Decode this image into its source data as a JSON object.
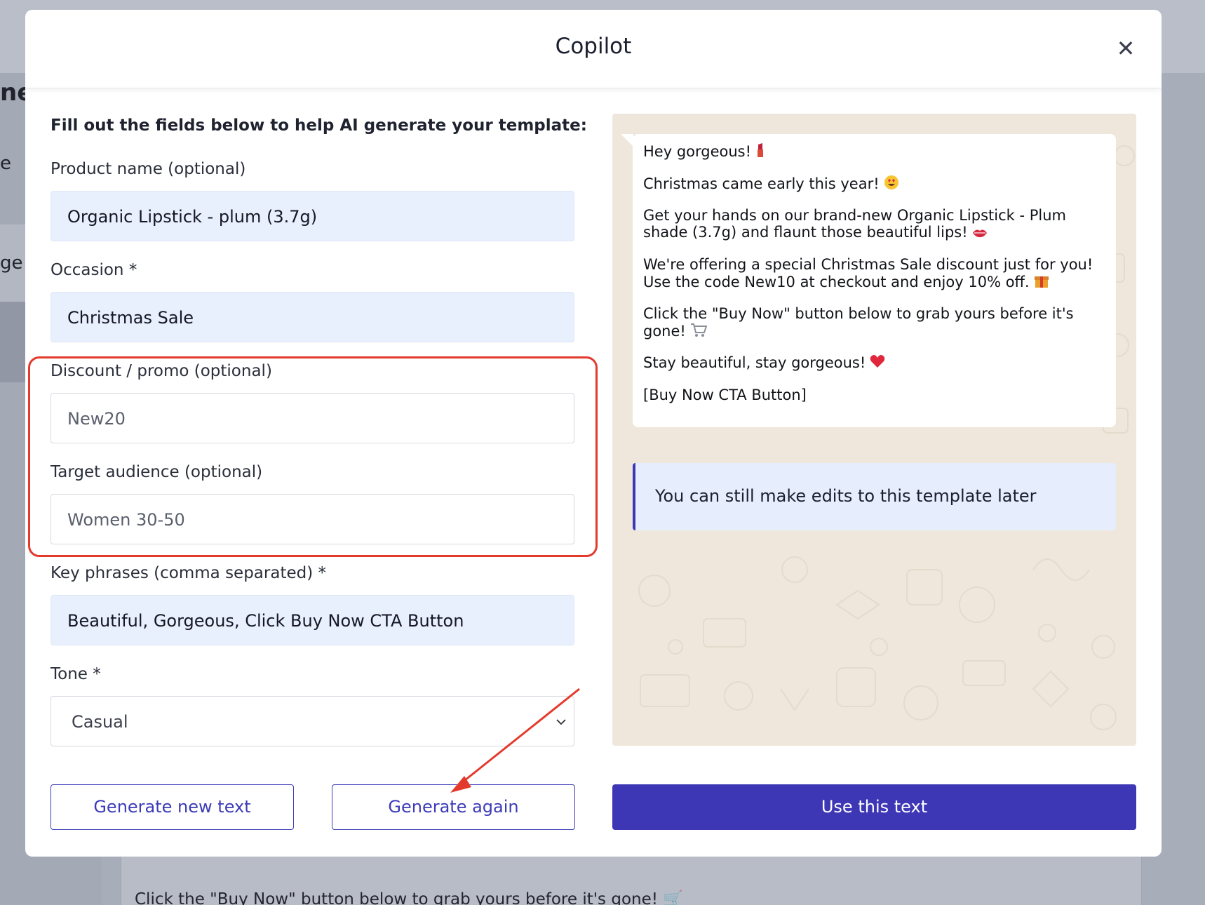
{
  "background": {
    "fragment_title": "nes",
    "fragment_a": "e",
    "fragment_b": "ge",
    "card_text": "Click the \"Buy Now\" button below to grab yours before it's gone! 🛒"
  },
  "modal": {
    "title": "Copilot",
    "close_icon": "close-icon"
  },
  "form": {
    "intro": "Fill out the fields below to help AI generate your template:",
    "product": {
      "label": "Product name (optional)",
      "value": "Organic Lipstick - plum (3.7g)"
    },
    "occasion": {
      "label": "Occasion *",
      "value": "Christmas Sale"
    },
    "discount": {
      "label": "Discount / promo (optional)",
      "placeholder": "New20"
    },
    "audience": {
      "label": "Target audience (optional)",
      "placeholder": "Women 30-50"
    },
    "key_phrases": {
      "label": "Key phrases (comma separated) *",
      "value": "Beautiful, Gorgeous, Click Buy Now CTA Button"
    },
    "tone": {
      "label": "Tone *",
      "value": "Casual"
    }
  },
  "buttons": {
    "generate_new": "Generate new text",
    "generate_again": "Generate again",
    "use_text": "Use this text"
  },
  "preview": {
    "lines": [
      "Hey gorgeous!",
      "Christmas came early this year!",
      "Get your hands on our brand-new Organic Lipstick - Plum",
      "shade (3.7g) and flaunt those beautiful lips!",
      "We're offering a special Christmas Sale discount just for you!",
      "Use the code New10 at checkout and enjoy 10% off.",
      "Click the \"Buy Now\" button below to grab yours before it's",
      "gone!",
      "Stay beautiful, stay gorgeous!",
      "[Buy Now CTA Button]"
    ],
    "note": "You can still make edits to this template later"
  },
  "colors": {
    "accent": "#3e37b5",
    "highlight": "#e33a2c",
    "field_fill": "#e8effd",
    "preview_bg": "#efe7dc"
  }
}
